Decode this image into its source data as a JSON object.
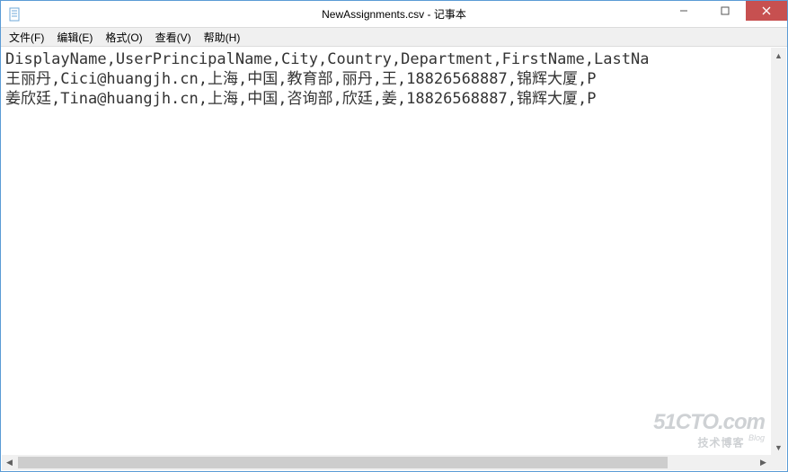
{
  "window": {
    "title": "NewAssignments.csv - 记事本"
  },
  "menu": {
    "file": "文件(F)",
    "edit": "编辑(E)",
    "format": "格式(O)",
    "view": "查看(V)",
    "help": "帮助(H)"
  },
  "content": {
    "text": "DisplayName,UserPrincipalName,City,Country,Department,FirstName,LastNa\n王丽丹,Cici@huangjh.cn,上海,中国,教育部,丽丹,王,18826568887,锦辉大厦,P\n姜欣廷,Tina@huangjh.cn,上海,中国,咨询部,欣廷,姜,18826568887,锦辉大厦,P"
  },
  "watermark": {
    "site": "51CTO.com",
    "tag": "技术博客",
    "blog": "Blog"
  }
}
